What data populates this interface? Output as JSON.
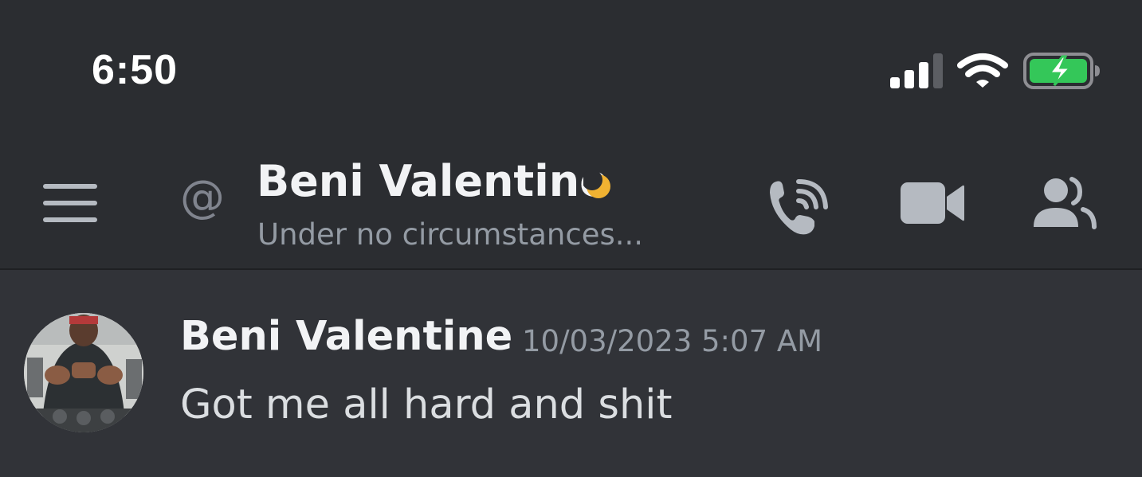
{
  "status_bar": {
    "time": "6:50",
    "signal_icon": "cellular-signal-icon",
    "signal_bars_filled": 3,
    "signal_bars_total": 4,
    "wifi_icon": "wifi-icon",
    "battery_icon": "battery-charging-icon",
    "battery_color": "#34c759"
  },
  "header": {
    "menu_icon": "hamburger-menu-icon",
    "channel_type_symbol": "@",
    "title": "Beni Valentine",
    "presence_icon": "idle-moon-icon",
    "presence_color": "#f0b232",
    "subtitle": "Under no circumstances...",
    "actions": [
      {
        "name": "voice-call",
        "icon": "phone-call-icon"
      },
      {
        "name": "video-call",
        "icon": "video-camera-icon"
      },
      {
        "name": "members",
        "icon": "members-icon"
      }
    ]
  },
  "messages": [
    {
      "author": "Beni Valentine",
      "timestamp": "10/03/2023 5:07 AM",
      "content": "Got me all hard and shit",
      "avatar_icon": "user-avatar"
    }
  ],
  "colors": {
    "header_bg": "#2b2d31",
    "chat_bg": "#313338",
    "icon_gray": "#b5bac1",
    "muted_text": "#949ba4"
  }
}
